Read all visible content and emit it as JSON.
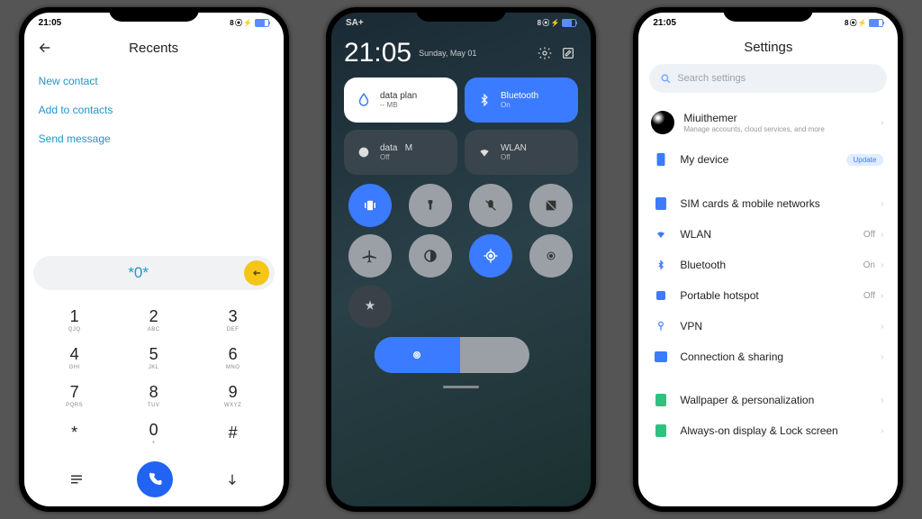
{
  "statusbar": {
    "time": "21:05",
    "carrier": "SA+",
    "icons": "8 ⦿ ⚡"
  },
  "dialer": {
    "title": "Recents",
    "links": [
      "New contact",
      "Add to contacts",
      "Send message"
    ],
    "entry": "*0*",
    "keys": [
      {
        "d": "1",
        "l": "QJQ"
      },
      {
        "d": "2",
        "l": "ABC"
      },
      {
        "d": "3",
        "l": "DEF"
      },
      {
        "d": "4",
        "l": "GHI"
      },
      {
        "d": "5",
        "l": "JKL"
      },
      {
        "d": "6",
        "l": "MNO"
      },
      {
        "d": "7",
        "l": "PQRS"
      },
      {
        "d": "8",
        "l": "TUV"
      },
      {
        "d": "9",
        "l": "WXYZ"
      },
      {
        "d": "*",
        "l": ""
      },
      {
        "d": "0",
        "l": "+"
      },
      {
        "d": "#",
        "l": ""
      }
    ]
  },
  "cc": {
    "time": "21:05",
    "date": "Sunday, May 01",
    "tiles": [
      {
        "title": "data plan",
        "sub": "-- MB",
        "style": "white",
        "icon": "drop"
      },
      {
        "title": "Bluetooth",
        "sub": "On",
        "style": "blue",
        "icon": "bt"
      },
      {
        "title": "data",
        "sub": "Off",
        "style": "dark",
        "icon": "globe",
        "extra": "M"
      },
      {
        "title": "WLAN",
        "sub": "Off",
        "style": "dark",
        "icon": "wifi"
      }
    ],
    "toggles": [
      {
        "c": "blue",
        "i": "vib"
      },
      {
        "c": "grey",
        "i": "torch"
      },
      {
        "c": "grey",
        "i": "mute"
      },
      {
        "c": "grey",
        "i": "dark"
      },
      {
        "c": "grey",
        "i": "plane"
      },
      {
        "c": "grey",
        "i": "contrast"
      },
      {
        "c": "blue",
        "i": "loc"
      },
      {
        "c": "grey",
        "i": "eye"
      },
      {
        "c": "dark",
        "i": "auto"
      }
    ]
  },
  "settings": {
    "title": "Settings",
    "search_placeholder": "Search settings",
    "account": {
      "name": "Miuithemer",
      "sub": "Manage accounts, cloud services, and more"
    },
    "mydevice": {
      "label": "My device",
      "badge": "Update"
    },
    "items": [
      {
        "icon": "sim",
        "label": "SIM cards & mobile networks",
        "val": ""
      },
      {
        "icon": "wifi",
        "label": "WLAN",
        "val": "Off"
      },
      {
        "icon": "bt",
        "label": "Bluetooth",
        "val": "On"
      },
      {
        "icon": "hotspot",
        "label": "Portable hotspot",
        "val": "Off"
      },
      {
        "icon": "vpn",
        "label": "VPN",
        "val": ""
      },
      {
        "icon": "share",
        "label": "Connection & sharing",
        "val": ""
      }
    ],
    "items2": [
      {
        "icon": "wall",
        "label": "Wallpaper & personalization"
      },
      {
        "icon": "aod",
        "label": "Always-on display & Lock screen"
      }
    ]
  }
}
